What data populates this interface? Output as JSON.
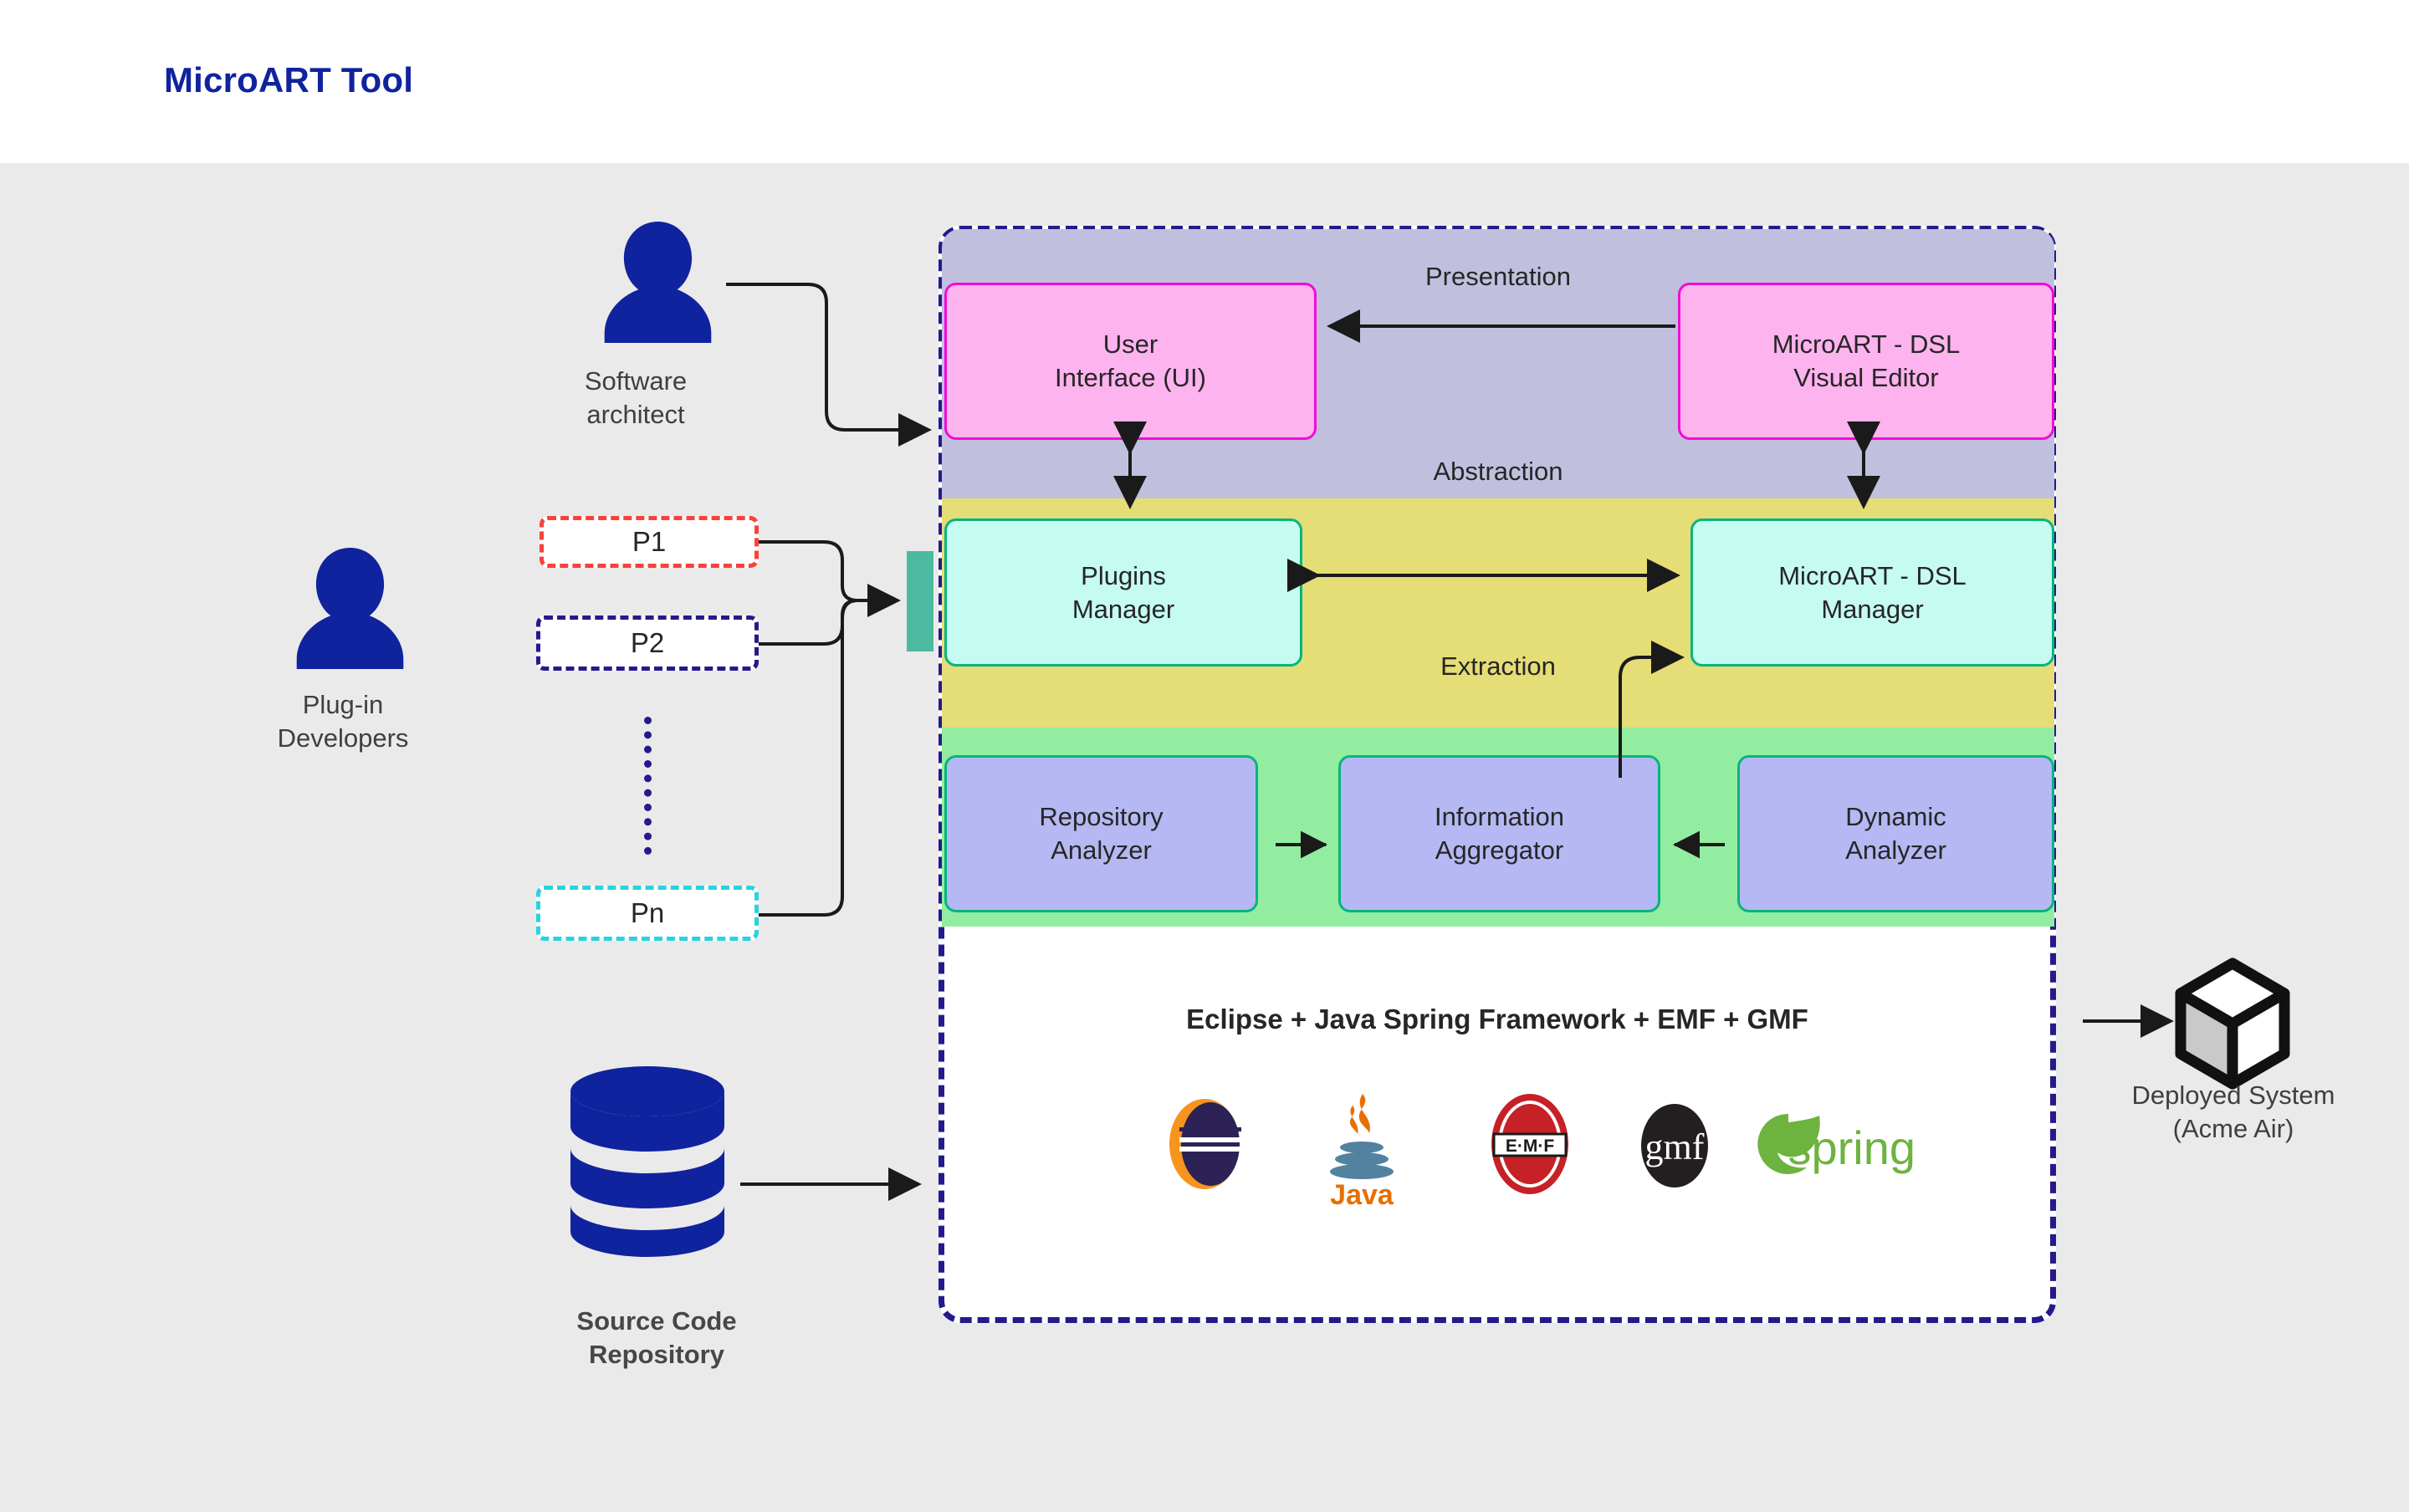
{
  "header": {
    "title": "MicroART Tool",
    "title_color": "#10239e"
  },
  "canvas": {
    "background": "#eaeaea"
  },
  "tool_container": {
    "border_color": "#241a8c",
    "border_style": "dashed"
  },
  "layers": [
    {
      "name": "presentation",
      "label": "Presentation",
      "color": "#c0c0de"
    },
    {
      "name": "abstraction",
      "label": "Abstraction",
      "color": "#e5dd76"
    },
    {
      "name": "extraction",
      "label": "Extraction",
      "color": "#93eda0"
    }
  ],
  "components": [
    {
      "id": "ui",
      "label": "User\nInterface (UI)",
      "fill": "#fcb3ee",
      "stroke": "#f50bd3"
    },
    {
      "id": "dsl_ed",
      "label": "MicroART - DSL\nVisual Editor",
      "fill": "#fcb3ee",
      "stroke": "#f50bd3"
    },
    {
      "id": "plugins",
      "label": "Plugins\nManager",
      "fill": "#c5fbf0",
      "stroke": "#08b47e"
    },
    {
      "id": "dsl_mgr",
      "label": "MicroART - DSL\nManager",
      "fill": "#c5fbf0",
      "stroke": "#08b47e"
    },
    {
      "id": "repo",
      "label": "Repository\nAnalyzer",
      "fill": "#b5b8f2",
      "stroke": "#08b47e"
    },
    {
      "id": "info",
      "label": "Information\nAggregator",
      "fill": "#b5b8f2",
      "stroke": "#08b47e"
    },
    {
      "id": "dyn",
      "label": "Dynamic\nAnalyzer",
      "fill": "#b5b8f2",
      "stroke": "#08b47e"
    }
  ],
  "tech_stack": {
    "title": "Eclipse + Java Spring Framework + EMF + GMF",
    "logos": [
      {
        "name": "eclipse-logo",
        "label": "Eclipse"
      },
      {
        "name": "java-logo",
        "label": "Java"
      },
      {
        "name": "emf-logo",
        "label": "E·M·F"
      },
      {
        "name": "gmf-logo",
        "label": "gmf"
      },
      {
        "name": "spring-logo",
        "label": "spring"
      }
    ]
  },
  "actors": {
    "software_architect": {
      "label": "Software\narchitect",
      "icon": "person-icon",
      "color": "#10239e"
    },
    "plugin_developers": {
      "label": "Plug-in\nDevelopers",
      "icon": "person-icon",
      "color": "#10239e"
    },
    "source_code_repository": {
      "label": "Source Code\nRepository",
      "icon": "database-cylinder-icon",
      "color": "#10239e"
    },
    "deployed_system": {
      "label": "Deployed System\n(Acme Air)",
      "icon": "cube-icon",
      "color": "#111111"
    }
  },
  "plugins": [
    {
      "id": "p1",
      "label": "P1",
      "border_color": "#f8423a"
    },
    {
      "id": "p2",
      "label": "P2",
      "border_color": "#241a8c"
    },
    {
      "id": "pn",
      "label": "Pn",
      "border_color": "#2ad2e0"
    }
  ],
  "connector_tab": {
    "name": "plugin-connector-tab",
    "color": "#4cb9a0"
  }
}
